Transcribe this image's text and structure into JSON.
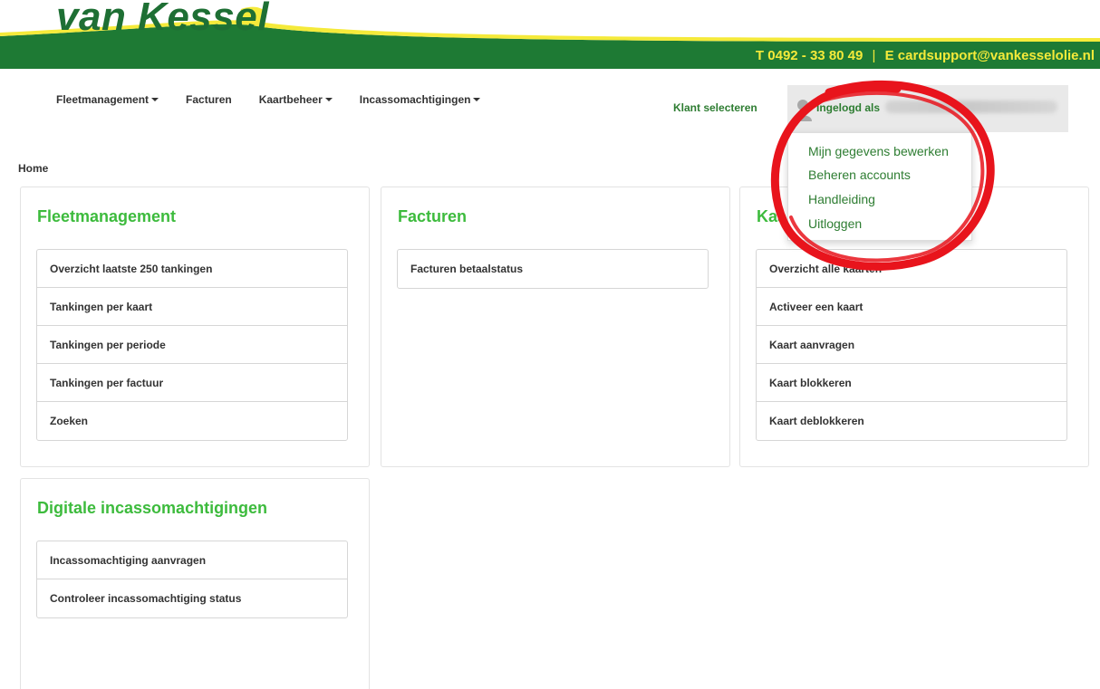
{
  "header": {
    "logo_text": "van Kessel",
    "phone_prefix": "T",
    "phone": "0492 - 33 80 49",
    "separator": "|",
    "email_prefix": "E",
    "email": "cardsupport@vankesselolie.nl",
    "brand_green": "#1e7a34",
    "accent_yellow": "#f5ea3a"
  },
  "nav": {
    "items": [
      {
        "label": "Fleetmanagement",
        "dropdown": true
      },
      {
        "label": "Facturen",
        "dropdown": false
      },
      {
        "label": "Kaartbeheer",
        "dropdown": true
      },
      {
        "label": "Incassomachtigingen",
        "dropdown": true
      }
    ],
    "klant_selecteren": "Klant selecteren",
    "login_label": "Ingelogd als"
  },
  "user_menu": {
    "items": [
      "Mijn gegevens bewerken",
      "Beheren accounts",
      "Handleiding",
      "Uitloggen"
    ]
  },
  "breadcrumb": "Home",
  "panels": {
    "fleet": {
      "title": "Fleetmanagement",
      "items": [
        "Overzicht laatste 250 tankingen",
        "Tankingen per kaart",
        "Tankingen per periode",
        "Tankingen per factuur",
        "Zoeken"
      ]
    },
    "facturen": {
      "title": "Facturen",
      "items": [
        "Facturen betaalstatus"
      ]
    },
    "kaart": {
      "title": "Kaa",
      "items": [
        "Overzicht alle kaarten",
        "Activeer een kaart",
        "Kaart aanvragen",
        "Kaart blokkeren",
        "Kaart deblokkeren"
      ]
    },
    "incasso": {
      "title": "Digitale incassomachtigingen",
      "items": [
        "Incassomachtiging aanvragen",
        "Controleer incassomachtiging status"
      ]
    }
  },
  "annotation_color": "#e8141c"
}
